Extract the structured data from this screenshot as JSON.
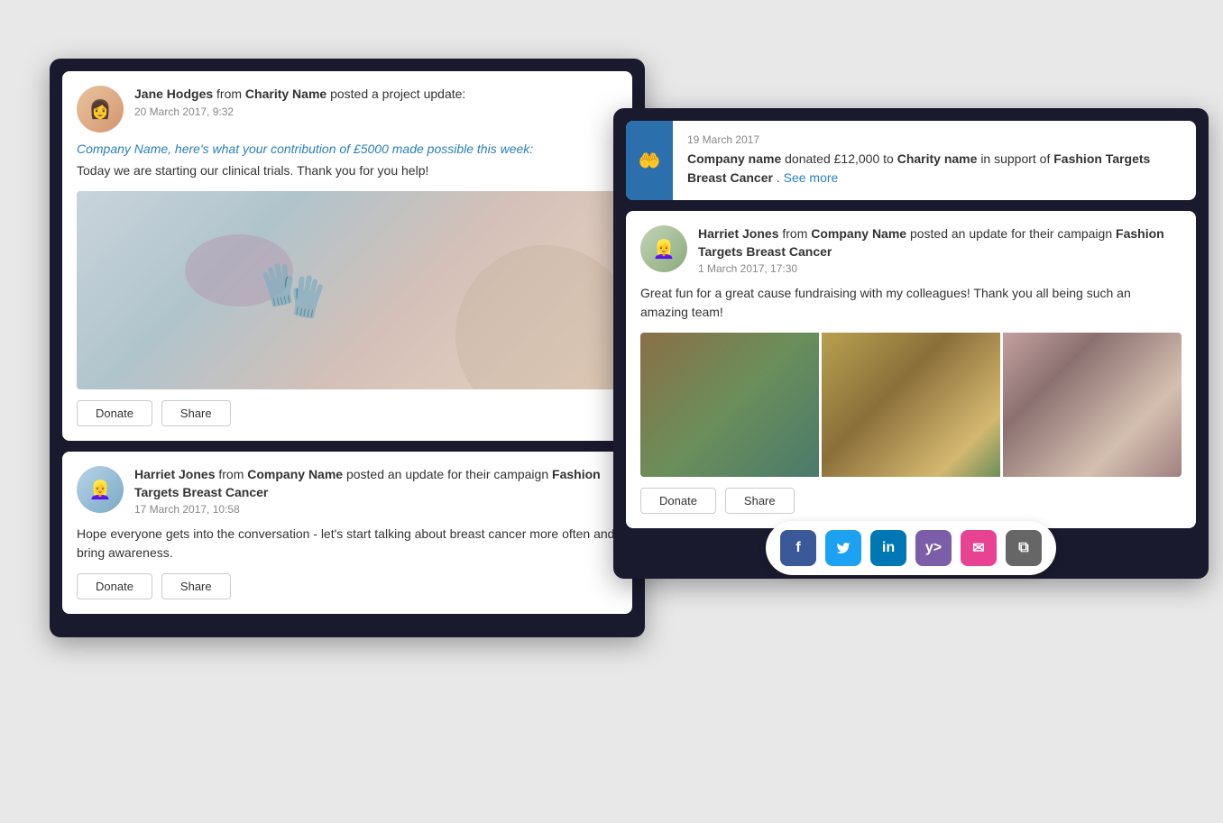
{
  "leftPanel": {
    "card1": {
      "author": "Jane Hodges",
      "from": "from",
      "charity": "Charity Name",
      "action": "posted a project update:",
      "timestamp": "20 March 2017, 9:32",
      "italicText": "Company Name, here's what your contribution of £5000 made possible this week:",
      "bodyText": "Today we are starting our clinical trials. Thank you for you help!",
      "donateLabel": "Donate",
      "shareLabel": "Share"
    },
    "card2": {
      "author": "Harriet Jones",
      "from": "from",
      "company": "Company Name",
      "action": "posted an update for their campaign",
      "campaign": "Fashion Targets Breast Cancer",
      "timestamp": "17 March 2017, 10:58",
      "bodyText": "Hope everyone gets into the conversation - let's start talking about breast cancer more often and bring awareness.",
      "donateLabel": "Donate",
      "shareLabel": "Share"
    }
  },
  "rightPanel": {
    "donationCard": {
      "date": "19 March 2017",
      "company": "Company name",
      "amount": "£12,000",
      "charity": "Charity name",
      "support": "Fashion Targets Breast Cancer",
      "seeMore": "See more"
    },
    "updateCard": {
      "author": "Harriet Jones",
      "from": "from",
      "company": "Company Name",
      "action": "posted an update for their campaign",
      "campaign": "Fashion Targets Breast Cancer",
      "timestamp": "1 March 2017, 17:30",
      "bodyText": "Great fun for a great cause fundraising with my colleagues! Thank you all being such an amazing team!",
      "donateLabel": "Donate",
      "shareLabel": "Share"
    },
    "socialBar": {
      "facebook": "f",
      "twitter": "t",
      "linkedin": "in",
      "yammer": "y>",
      "email": "✉",
      "copy": "⧉"
    }
  }
}
